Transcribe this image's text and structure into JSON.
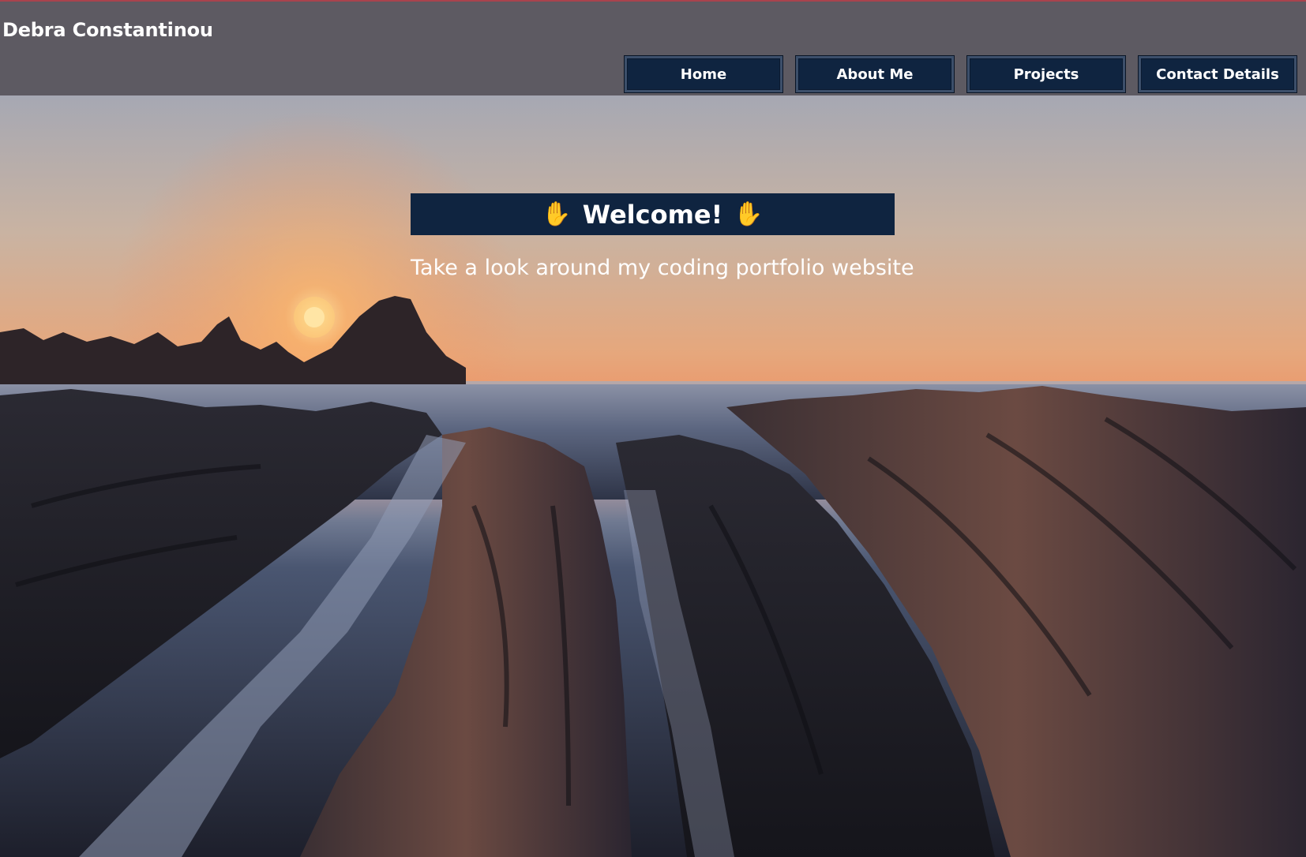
{
  "header": {
    "site_title": "Debra Constantinou",
    "nav": [
      {
        "label": "Home"
      },
      {
        "label": "About Me"
      },
      {
        "label": "Projects"
      },
      {
        "label": "Contact Details"
      }
    ]
  },
  "hero": {
    "welcome_text": "Welcome!",
    "welcome_icon": "raised-hand-icon",
    "tagline": "Take a look around my coding portfolio website",
    "background": "sunset over rocky seashore"
  },
  "colors": {
    "header_bg": "#5d5a62",
    "nav_button_bg": "#0f2440",
    "welcome_bg": "#0f2440",
    "hand_icon": "#f5b91e",
    "text": "#ffffff"
  }
}
